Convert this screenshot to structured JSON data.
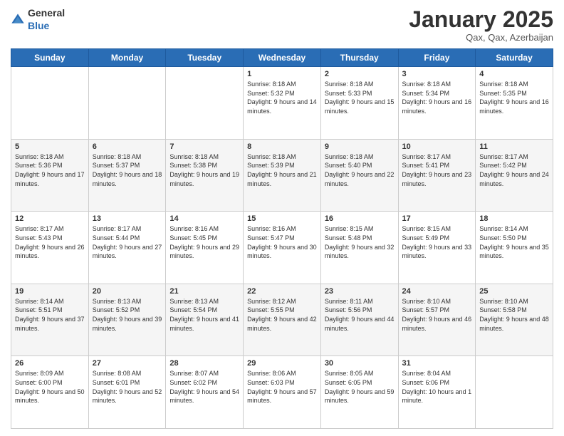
{
  "header": {
    "logo": {
      "general": "General",
      "blue": "Blue"
    },
    "title": "January 2025",
    "location": "Qax, Qax, Azerbaijan"
  },
  "weekdays": [
    "Sunday",
    "Monday",
    "Tuesday",
    "Wednesday",
    "Thursday",
    "Friday",
    "Saturday"
  ],
  "weeks": [
    [
      {
        "day": "",
        "sunrise": "",
        "sunset": "",
        "daylight": ""
      },
      {
        "day": "",
        "sunrise": "",
        "sunset": "",
        "daylight": ""
      },
      {
        "day": "",
        "sunrise": "",
        "sunset": "",
        "daylight": ""
      },
      {
        "day": "1",
        "sunrise": "Sunrise: 8:18 AM",
        "sunset": "Sunset: 5:32 PM",
        "daylight": "Daylight: 9 hours and 14 minutes."
      },
      {
        "day": "2",
        "sunrise": "Sunrise: 8:18 AM",
        "sunset": "Sunset: 5:33 PM",
        "daylight": "Daylight: 9 hours and 15 minutes."
      },
      {
        "day": "3",
        "sunrise": "Sunrise: 8:18 AM",
        "sunset": "Sunset: 5:34 PM",
        "daylight": "Daylight: 9 hours and 16 minutes."
      },
      {
        "day": "4",
        "sunrise": "Sunrise: 8:18 AM",
        "sunset": "Sunset: 5:35 PM",
        "daylight": "Daylight: 9 hours and 16 minutes."
      }
    ],
    [
      {
        "day": "5",
        "sunrise": "Sunrise: 8:18 AM",
        "sunset": "Sunset: 5:36 PM",
        "daylight": "Daylight: 9 hours and 17 minutes."
      },
      {
        "day": "6",
        "sunrise": "Sunrise: 8:18 AM",
        "sunset": "Sunset: 5:37 PM",
        "daylight": "Daylight: 9 hours and 18 minutes."
      },
      {
        "day": "7",
        "sunrise": "Sunrise: 8:18 AM",
        "sunset": "Sunset: 5:38 PM",
        "daylight": "Daylight: 9 hours and 19 minutes."
      },
      {
        "day": "8",
        "sunrise": "Sunrise: 8:18 AM",
        "sunset": "Sunset: 5:39 PM",
        "daylight": "Daylight: 9 hours and 21 minutes."
      },
      {
        "day": "9",
        "sunrise": "Sunrise: 8:18 AM",
        "sunset": "Sunset: 5:40 PM",
        "daylight": "Daylight: 9 hours and 22 minutes."
      },
      {
        "day": "10",
        "sunrise": "Sunrise: 8:17 AM",
        "sunset": "Sunset: 5:41 PM",
        "daylight": "Daylight: 9 hours and 23 minutes."
      },
      {
        "day": "11",
        "sunrise": "Sunrise: 8:17 AM",
        "sunset": "Sunset: 5:42 PM",
        "daylight": "Daylight: 9 hours and 24 minutes."
      }
    ],
    [
      {
        "day": "12",
        "sunrise": "Sunrise: 8:17 AM",
        "sunset": "Sunset: 5:43 PM",
        "daylight": "Daylight: 9 hours and 26 minutes."
      },
      {
        "day": "13",
        "sunrise": "Sunrise: 8:17 AM",
        "sunset": "Sunset: 5:44 PM",
        "daylight": "Daylight: 9 hours and 27 minutes."
      },
      {
        "day": "14",
        "sunrise": "Sunrise: 8:16 AM",
        "sunset": "Sunset: 5:45 PM",
        "daylight": "Daylight: 9 hours and 29 minutes."
      },
      {
        "day": "15",
        "sunrise": "Sunrise: 8:16 AM",
        "sunset": "Sunset: 5:47 PM",
        "daylight": "Daylight: 9 hours and 30 minutes."
      },
      {
        "day": "16",
        "sunrise": "Sunrise: 8:15 AM",
        "sunset": "Sunset: 5:48 PM",
        "daylight": "Daylight: 9 hours and 32 minutes."
      },
      {
        "day": "17",
        "sunrise": "Sunrise: 8:15 AM",
        "sunset": "Sunset: 5:49 PM",
        "daylight": "Daylight: 9 hours and 33 minutes."
      },
      {
        "day": "18",
        "sunrise": "Sunrise: 8:14 AM",
        "sunset": "Sunset: 5:50 PM",
        "daylight": "Daylight: 9 hours and 35 minutes."
      }
    ],
    [
      {
        "day": "19",
        "sunrise": "Sunrise: 8:14 AM",
        "sunset": "Sunset: 5:51 PM",
        "daylight": "Daylight: 9 hours and 37 minutes."
      },
      {
        "day": "20",
        "sunrise": "Sunrise: 8:13 AM",
        "sunset": "Sunset: 5:52 PM",
        "daylight": "Daylight: 9 hours and 39 minutes."
      },
      {
        "day": "21",
        "sunrise": "Sunrise: 8:13 AM",
        "sunset": "Sunset: 5:54 PM",
        "daylight": "Daylight: 9 hours and 41 minutes."
      },
      {
        "day": "22",
        "sunrise": "Sunrise: 8:12 AM",
        "sunset": "Sunset: 5:55 PM",
        "daylight": "Daylight: 9 hours and 42 minutes."
      },
      {
        "day": "23",
        "sunrise": "Sunrise: 8:11 AM",
        "sunset": "Sunset: 5:56 PM",
        "daylight": "Daylight: 9 hours and 44 minutes."
      },
      {
        "day": "24",
        "sunrise": "Sunrise: 8:10 AM",
        "sunset": "Sunset: 5:57 PM",
        "daylight": "Daylight: 9 hours and 46 minutes."
      },
      {
        "day": "25",
        "sunrise": "Sunrise: 8:10 AM",
        "sunset": "Sunset: 5:58 PM",
        "daylight": "Daylight: 9 hours and 48 minutes."
      }
    ],
    [
      {
        "day": "26",
        "sunrise": "Sunrise: 8:09 AM",
        "sunset": "Sunset: 6:00 PM",
        "daylight": "Daylight: 9 hours and 50 minutes."
      },
      {
        "day": "27",
        "sunrise": "Sunrise: 8:08 AM",
        "sunset": "Sunset: 6:01 PM",
        "daylight": "Daylight: 9 hours and 52 minutes."
      },
      {
        "day": "28",
        "sunrise": "Sunrise: 8:07 AM",
        "sunset": "Sunset: 6:02 PM",
        "daylight": "Daylight: 9 hours and 54 minutes."
      },
      {
        "day": "29",
        "sunrise": "Sunrise: 8:06 AM",
        "sunset": "Sunset: 6:03 PM",
        "daylight": "Daylight: 9 hours and 57 minutes."
      },
      {
        "day": "30",
        "sunrise": "Sunrise: 8:05 AM",
        "sunset": "Sunset: 6:05 PM",
        "daylight": "Daylight: 9 hours and 59 minutes."
      },
      {
        "day": "31",
        "sunrise": "Sunrise: 8:04 AM",
        "sunset": "Sunset: 6:06 PM",
        "daylight": "Daylight: 10 hours and 1 minute."
      },
      {
        "day": "",
        "sunrise": "",
        "sunset": "",
        "daylight": ""
      }
    ]
  ]
}
